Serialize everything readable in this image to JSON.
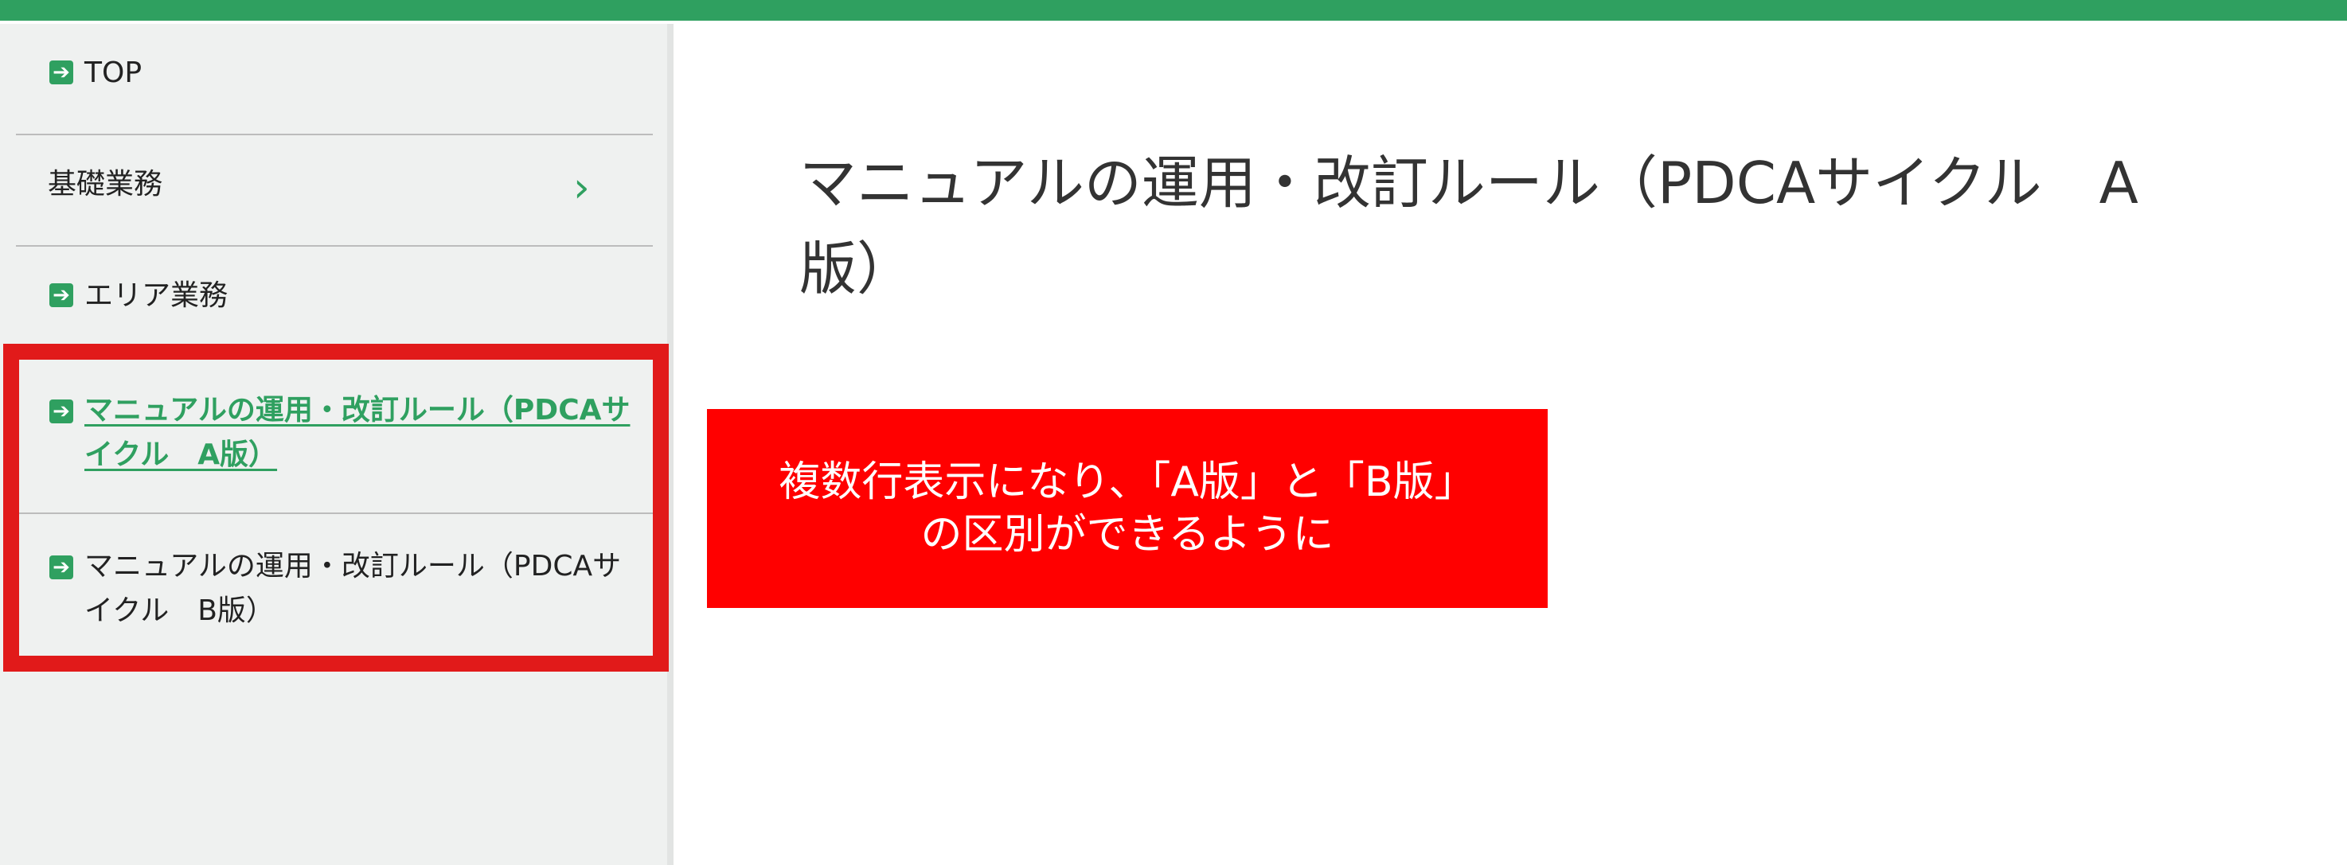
{
  "sidebar": {
    "items": [
      {
        "label": "TOP"
      },
      {
        "label": "基礎業務"
      },
      {
        "label": "エリア業務"
      },
      {
        "label": "マニュアルの運用・改訂ルール（PDCAサイクル　A版）"
      },
      {
        "label": "マニュアルの運用・改訂ルール（PDCAサイクル　B版）"
      }
    ]
  },
  "main": {
    "title": "マニュアルの運用・改訂ルール（PDCAサイクル　A版）"
  },
  "annotation": {
    "line1": "複数行表示になり、「A版」と「B版」",
    "line2": "の区別ができるように"
  },
  "icons": {
    "nav_item": "arrow-right-square-icon",
    "expand": "chevron-right-icon"
  },
  "colors": {
    "accent": "#2fa060",
    "highlight": "#e11a1a",
    "callout": "#ff0000"
  }
}
